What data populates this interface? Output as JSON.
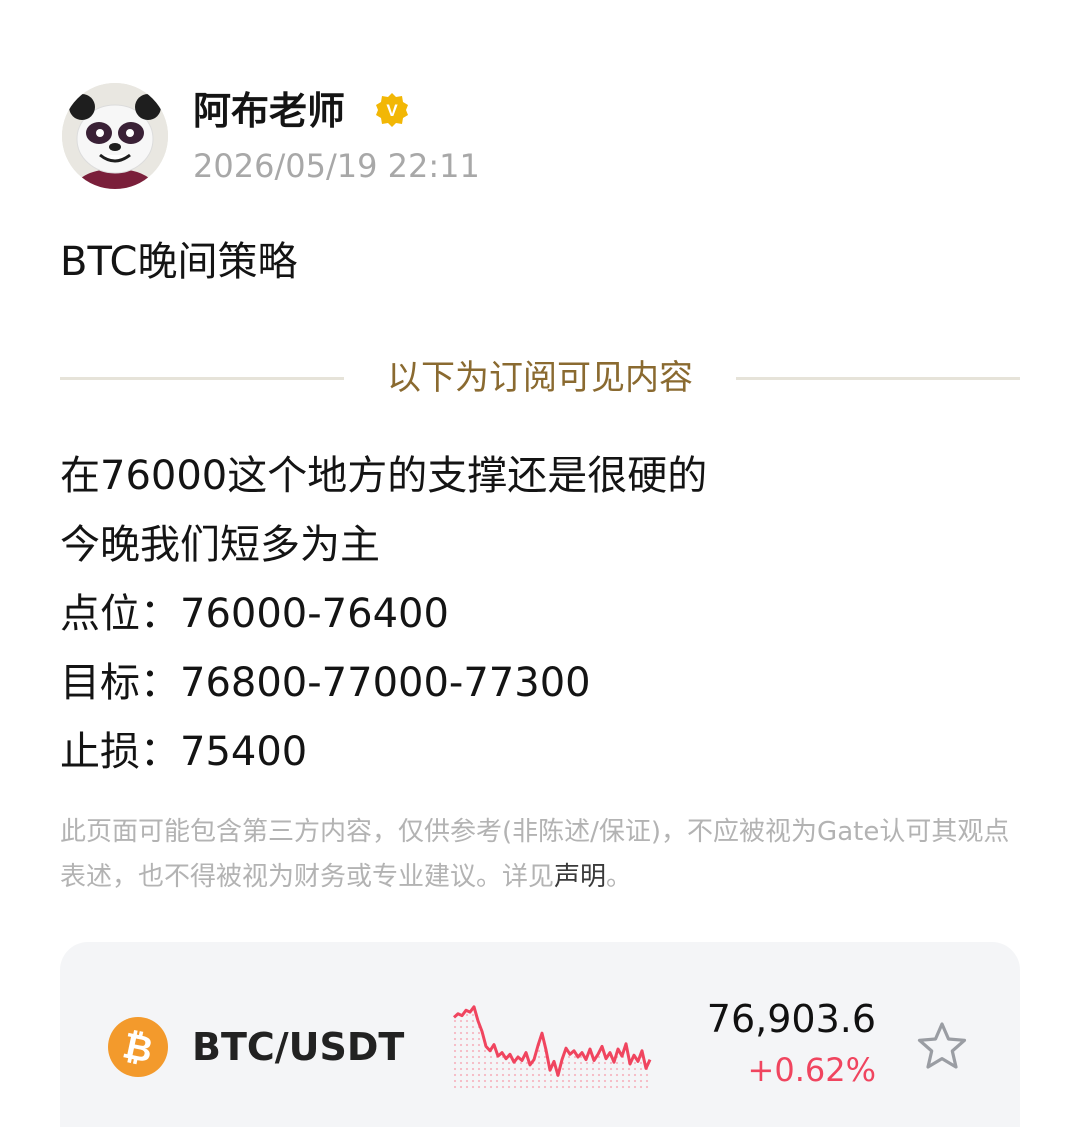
{
  "author": {
    "name": "阿布老师",
    "avatar_icon": "panda-avatar",
    "verified_icon": "verified-badge-icon",
    "verified_mark": "V",
    "timestamp": "2026/05/19 22:11"
  },
  "post": {
    "title": "BTC晚间策略",
    "paywall_divider": "以下为订阅可见内容",
    "content_lines": [
      "在76000这个地方的支撑还是很硬的",
      "今晚我们短多为主",
      "点位：76000-76400",
      "目标：76800-77000-77300",
      "止损：75400"
    ],
    "disclaimer_text": "此页面可能包含第三方内容，仅供参考(非陈述/保证)，不应被视为Gate认可其观点表述，也不得被视为财务或专业建议。详见",
    "disclaimer_link": "声明",
    "disclaimer_end": "。"
  },
  "ticker": {
    "coin_icon": "bitcoin-icon",
    "pair": "BTC/USDT",
    "price": "76,903.6",
    "change": "+0.62%",
    "favorite_icon": "star-icon",
    "sparkline_trend": [
      0.78,
      0.82,
      0.8,
      0.86,
      0.84,
      0.9,
      0.74,
      0.62,
      0.45,
      0.4,
      0.47,
      0.34,
      0.38,
      0.31,
      0.36,
      0.27,
      0.33,
      0.29,
      0.38,
      0.24,
      0.3,
      0.46,
      0.6,
      0.41,
      0.18,
      0.28,
      0.12,
      0.3,
      0.43,
      0.36,
      0.4,
      0.33,
      0.38,
      0.3,
      0.42,
      0.29,
      0.36,
      0.45,
      0.31,
      0.38,
      0.27,
      0.42,
      0.34,
      0.48,
      0.25,
      0.35,
      0.28,
      0.4,
      0.2,
      0.3
    ]
  },
  "colors": {
    "divider_text": "#8a6a30",
    "price_up": "#f0455f",
    "bitcoin_orange": "#f39a2c",
    "verified_gold": "#f2b705"
  }
}
